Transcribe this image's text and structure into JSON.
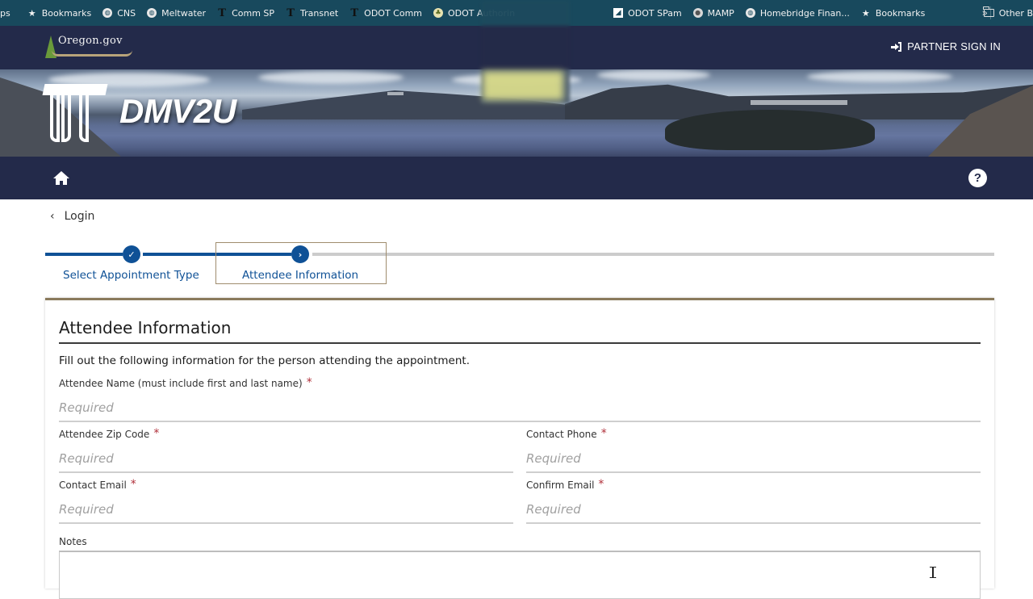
{
  "bookmarks_bar": {
    "items": [
      {
        "label": "ps",
        "icon": "none"
      },
      {
        "label": "Bookmarks",
        "icon": "star-icon"
      },
      {
        "label": "CNS",
        "icon": "globe-icon"
      },
      {
        "label": "Meltwater",
        "icon": "globe-icon"
      },
      {
        "label": "Comm SP",
        "icon": "odot-t-icon"
      },
      {
        "label": "Transnet",
        "icon": "odot-t-icon"
      },
      {
        "label": "ODOT Comm",
        "icon": "odot-t-icon"
      },
      {
        "label": "ODOT Authorin",
        "icon": "leaf-icon"
      },
      {
        "label": "ODOT SPam",
        "icon": "chart-icon"
      },
      {
        "label": "MAMP",
        "icon": "elephant-icon"
      },
      {
        "label": "Homebridge Finan...",
        "icon": "globe-icon"
      },
      {
        "label": "Bookmarks",
        "icon": "star-icon"
      }
    ],
    "overflow_label": "»",
    "other_label": "Other B"
  },
  "header": {
    "site_logo": "Oregon.gov",
    "partner_signin_label": "PARTNER SIGN IN"
  },
  "banner": {
    "app_title": "DMV2U"
  },
  "nav": {
    "home_icon": "home-icon",
    "help_icon": "question-circle-icon",
    "help_glyph": "?"
  },
  "back_link": {
    "label": "Login",
    "glyph": "‹"
  },
  "stepper": {
    "progress_percent": 27,
    "steps": [
      {
        "label": "Select Appointment Type",
        "status": "complete",
        "glyph": "✓"
      },
      {
        "label": "Attendee Information",
        "status": "current",
        "glyph": "›"
      }
    ]
  },
  "form": {
    "title": "Attendee Information",
    "intro": "Fill out the following information for the person attending the appointment.",
    "required_marker": "*",
    "fields": {
      "attendee_name": {
        "label": "Attendee Name (must include first and last name)",
        "placeholder": "Required",
        "value": "",
        "required": true
      },
      "zip_code": {
        "label": "Attendee Zip Code",
        "placeholder": "Required",
        "value": "",
        "required": true
      },
      "contact_phone": {
        "label": "Contact Phone",
        "placeholder": "Required",
        "value": "",
        "required": true
      },
      "contact_email": {
        "label": "Contact Email",
        "placeholder": "Required",
        "value": "",
        "required": true
      },
      "confirm_email": {
        "label": "Confirm Email",
        "placeholder": "Required",
        "value": "",
        "required": true
      }
    },
    "notes": {
      "label": "Notes",
      "value": ""
    }
  },
  "colors": {
    "bookmarks_bar_bg": "#18495d",
    "header_bg": "#232a4a",
    "step_accent": "#0f5196",
    "step_inactive": "#cccccc",
    "card_top_border": "#8a7a5c",
    "required_marker": "#b0303a"
  }
}
